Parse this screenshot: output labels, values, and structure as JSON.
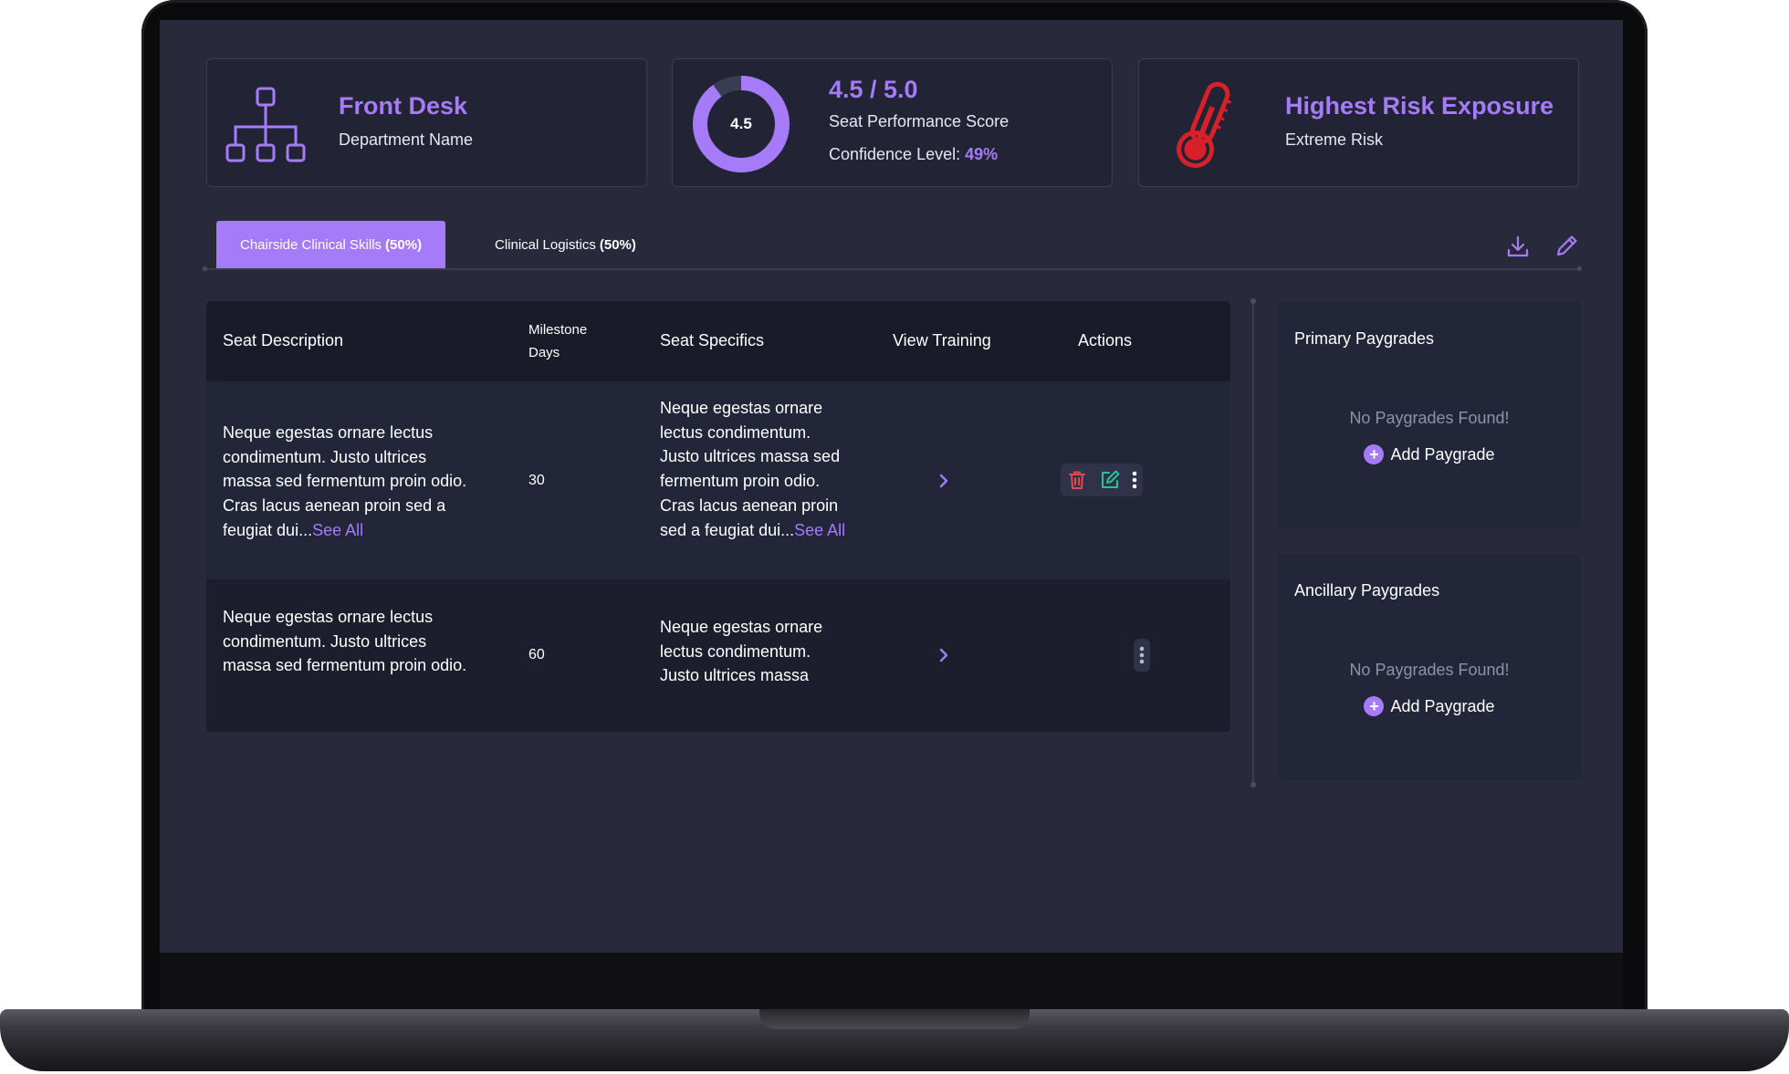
{
  "cards": {
    "department": {
      "title": "Front Desk",
      "subtitle": "Department Name",
      "icon": "org-chart-icon"
    },
    "performance": {
      "donut_value": "4.5",
      "score_fraction": 0.9,
      "title": "4.5 / 5.0",
      "subtitle": "Seat Performance Score",
      "confidence_label": "Confidence Level:",
      "confidence_value": "49%"
    },
    "risk": {
      "title": "Highest Risk Exposure",
      "subtitle": "Extreme Risk",
      "icon": "thermometer-icon"
    }
  },
  "tabs": [
    {
      "label": "Chairside Clinical Skills",
      "pct": "(50%)",
      "active": true
    },
    {
      "label": "Clinical Logistics",
      "pct": "(50%)",
      "active": false
    }
  ],
  "toolbar": {
    "download_icon": "download-icon",
    "edit_icon": "pencil-icon"
  },
  "table": {
    "headers": {
      "description": "Seat Description",
      "milestone_line1": "Milestone",
      "milestone_line2": "Days",
      "specifics": "Seat Specifics",
      "training": "View Training",
      "actions": "Actions"
    },
    "rows": [
      {
        "description": "Neque egestas ornare lectus condimentum. Justo ultrices massa sed fermentum proin odio. Cras lacus aenean proin sed a feugiat dui...",
        "description_more": "See All",
        "milestone": "30",
        "specifics": "Neque egestas ornare lectus condimentum. Justo ultrices massa sed fermentum proin odio. Cras lacus aenean proin sed a feugiat dui...",
        "specifics_more": "See All"
      },
      {
        "description": "Neque egestas ornare lectus condimentum. Justo ultrices massa sed fermentum proin odio.",
        "milestone": "60",
        "specifics": "Neque egestas ornare lectus condimentum. Justo ultrices massa"
      }
    ]
  },
  "panels": {
    "primary": {
      "title": "Primary Paygrades",
      "empty": "No Paygrades Found!",
      "add": "Add Paygrade"
    },
    "ancillary": {
      "title": "Ancillary Paygrades",
      "empty": "No Paygrades Found!",
      "add": "Add Paygrade"
    }
  },
  "colors": {
    "accent": "#a57bfa",
    "danger": "#e5484d",
    "success": "#2bbf9a",
    "background": "#282a3b"
  }
}
